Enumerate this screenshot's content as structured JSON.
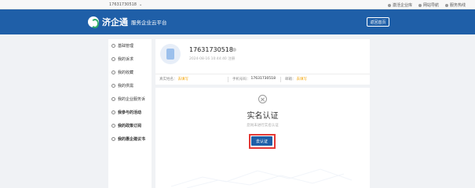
{
  "topbar": {
    "account": "17631730518",
    "links": [
      "激活企业库",
      "网站导航",
      "服务热线"
    ]
  },
  "header": {
    "logo_name": "济企通",
    "logo_sub": "服务企业云平台",
    "home_button": "返回首页"
  },
  "sidebar": {
    "items": [
      {
        "label": "基础管理",
        "bold": false
      },
      {
        "label": "我的诉求",
        "bold": false
      },
      {
        "label": "我的收藏",
        "bold": false
      },
      {
        "label": "我的供需",
        "bold": false
      },
      {
        "label": "我的企业服务诉",
        "bold": false
      },
      {
        "label": "我参与的活动",
        "bold": true
      },
      {
        "label": "我的政策订阅",
        "bold": true
      },
      {
        "label": "我的惠企建议书",
        "bold": true
      }
    ]
  },
  "profile": {
    "phone": "17631730518",
    "register_time": "2024-08-16 10:44:40 注册",
    "info": [
      {
        "label": "真实姓名：",
        "value": "去填写",
        "type": "link"
      },
      {
        "label": "手机号码：",
        "value": "17631730518",
        "type": "text"
      },
      {
        "label": "邮箱：",
        "value": "去填写",
        "type": "link"
      }
    ]
  },
  "verification": {
    "title": "实名认证",
    "subtitle": "您尚未进行实名认证",
    "button": "去认证"
  },
  "colors": {
    "brand": "#1f5fa8",
    "highlight": "#e53935",
    "link": "#f2a200"
  }
}
